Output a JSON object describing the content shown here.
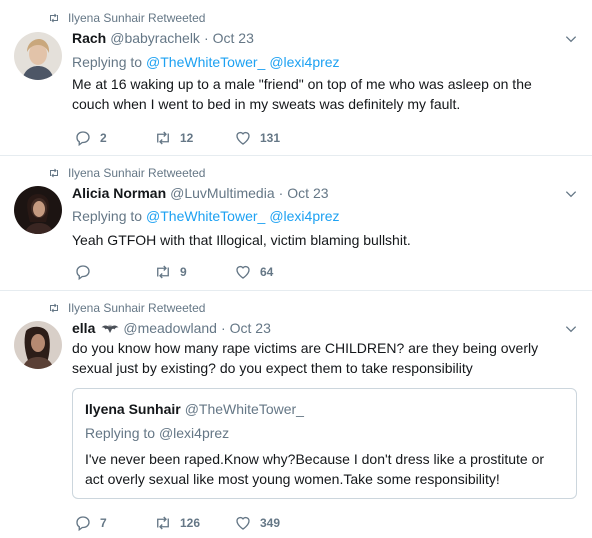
{
  "tweets": [
    {
      "retweeted_by": "Ilyena Sunhair Retweeted",
      "name": "Rach",
      "handle": "@babyrachelk",
      "dot": "·",
      "time": "Oct 23",
      "replying_label": "Replying to",
      "replying_to": [
        "@TheWhiteTower_",
        "@lexi4prez"
      ],
      "text": "Me at 16 waking up to a male \"friend\" on top of me who was asleep on the couch when I went to bed in my sweats was definitely my fault.",
      "replies": "2",
      "retweets": "12",
      "likes": "131",
      "avatar_colors": [
        "#d9d2c8",
        "#b99a80"
      ]
    },
    {
      "retweeted_by": "Ilyena Sunhair Retweeted",
      "name": "Alicia Norman",
      "handle": "@LuvMultimedia",
      "dot": "·",
      "time": "Oct 23",
      "replying_label": "Replying to",
      "replying_to": [
        "@TheWhiteTower_",
        "@lexi4prez"
      ],
      "text": "Yeah GTFOH with that Illogical, victim blaming bullshit.",
      "replies": "",
      "retweets": "9",
      "likes": "64",
      "avatar_colors": [
        "#2a1d1a",
        "#6b4b3e"
      ]
    },
    {
      "retweeted_by": "Ilyena Sunhair Retweeted",
      "name": "ella",
      "handle": "@meadowland",
      "dot": "·",
      "time": "Oct 23",
      "text": "do you know how many rape victims are CHILDREN? are they being overly sexual just by existing? do you expect them to take responsibility",
      "replies": "7",
      "retweets": "126",
      "likes": "349",
      "avatar_colors": [
        "#3a2a25",
        "#a07a66"
      ],
      "quote": {
        "name": "Ilyena Sunhair",
        "handle": "@TheWhiteTower_",
        "replying_label": "Replying to",
        "replying_to": "@lexi4prez",
        "text": "I've never been raped.Know why?Because I don't dress like a prostitute or act overly sexual like most young women.Take some responsibility!"
      }
    }
  ],
  "colors": {
    "link": "#1da1f2",
    "secondary": "#657786",
    "border": "#e6ecf0"
  },
  "icons": [
    "retweet-icon",
    "caret-down-icon",
    "reply-icon",
    "like-icon",
    "bat-emoji"
  ]
}
